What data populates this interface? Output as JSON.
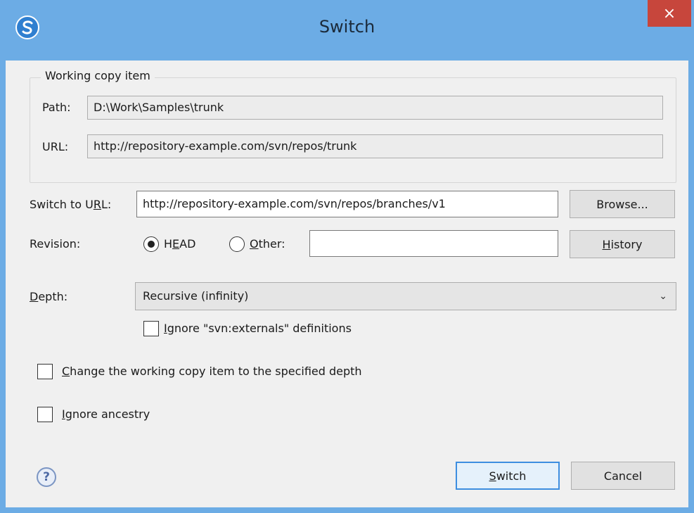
{
  "window": {
    "title": "Switch",
    "close_glyph": "×",
    "app_icon": "svn-s-icon"
  },
  "working_copy": {
    "legend": "Working copy item",
    "path_label": "Path:",
    "path_value": "D:\\Work\\Samples\\trunk",
    "url_label": "URL:",
    "url_value": "http://repository-example.com/svn/repos/trunk"
  },
  "switch_to": {
    "label_pre": "Switch to U",
    "label_ul": "R",
    "label_post": "L:",
    "url_value": "http://repository-example.com/svn/repos/branches/v1",
    "browse_pre": "B",
    "browse_ul": "",
    "browse_text": "Browse..."
  },
  "revision": {
    "label": "Revision:",
    "head_pre": "H",
    "head_ul": "E",
    "head_post": "AD",
    "head_selected": true,
    "other_ul": "O",
    "other_post": "ther:",
    "other_value": "",
    "history_ul": "H",
    "history_post": "istory"
  },
  "depth": {
    "label_ul": "D",
    "label_post": "epth:",
    "selected": "Recursive (infinity)",
    "dropdown_icon": "chevron-down-icon"
  },
  "options": {
    "ignore_externals_ul": "I",
    "ignore_externals_post": "gnore \"svn:externals\" definitions",
    "ignore_externals_checked": false,
    "change_depth_ul": "C",
    "change_depth_post": "hange the working copy item to the specified depth",
    "change_depth_checked": false,
    "ignore_ancestry_ul": "I",
    "ignore_ancestry_post": "gnore ancestry",
    "ignore_ancestry_checked": false
  },
  "footer": {
    "help_glyph": "?",
    "switch_ul": "S",
    "switch_post": "witch",
    "cancel_label": "Cancel"
  },
  "colors": {
    "titlebar": "#6cace5",
    "close": "#c7463c",
    "client": "#f0f0f0",
    "default_button_border": "#3d8ee0"
  }
}
